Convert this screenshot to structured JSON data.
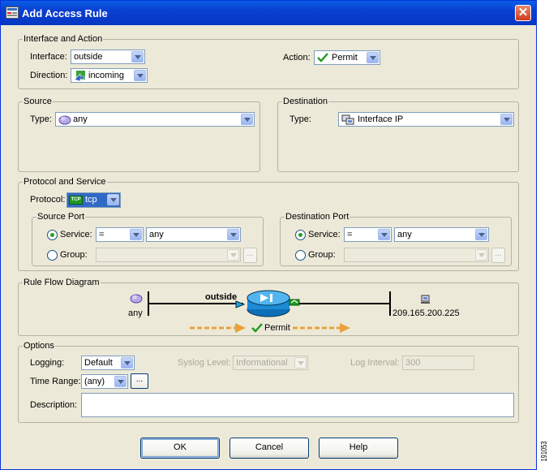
{
  "window": {
    "title": "Add Access Rule"
  },
  "interface_action": {
    "legend": "Interface and Action",
    "interface_label": "Interface:",
    "interface_value": "outside",
    "direction_label": "Direction:",
    "direction_value": "incoming",
    "action_label": "Action:",
    "action_value": "Permit"
  },
  "source": {
    "legend": "Source",
    "type_label": "Type:",
    "type_value": "any"
  },
  "destination": {
    "legend": "Destination",
    "type_label": "Type:",
    "type_value": "Interface IP"
  },
  "protocol_service": {
    "legend": "Protocol and Service",
    "protocol_label": "Protocol:",
    "protocol_badge": "TCP",
    "protocol_value": "tcp",
    "source_port": {
      "legend": "Source Port",
      "service_label": "Service:",
      "service_op": "=",
      "service_value": "any",
      "group_label": "Group:",
      "browse": "..."
    },
    "destination_port": {
      "legend": "Destination Port",
      "service_label": "Service:",
      "service_op": "=",
      "service_value": "any",
      "group_label": "Group:",
      "browse": "..."
    }
  },
  "rule_flow": {
    "legend": "Rule Flow Diagram",
    "interface_name": "outside",
    "source_label": "any",
    "destination_label": "209.165.200.225",
    "action_label": "Permit"
  },
  "options": {
    "legend": "Options",
    "logging_label": "Logging:",
    "logging_value": "Default",
    "syslog_label": "Syslog Level:",
    "syslog_value": "Informational",
    "interval_label": "Log Interval:",
    "interval_value": "300",
    "time_range_label": "Time Range:",
    "time_range_value": "(any)",
    "time_range_browse": "...",
    "description_label": "Description:",
    "description_value": ""
  },
  "buttons": {
    "ok": "OK",
    "cancel": "Cancel",
    "help": "Help"
  },
  "figure_id": "191053",
  "colors": {
    "titlebar": "#0a3fd0",
    "dialog_bg": "#ece9d8",
    "arrow": "#e8a23c",
    "selection": "#316ac5"
  }
}
